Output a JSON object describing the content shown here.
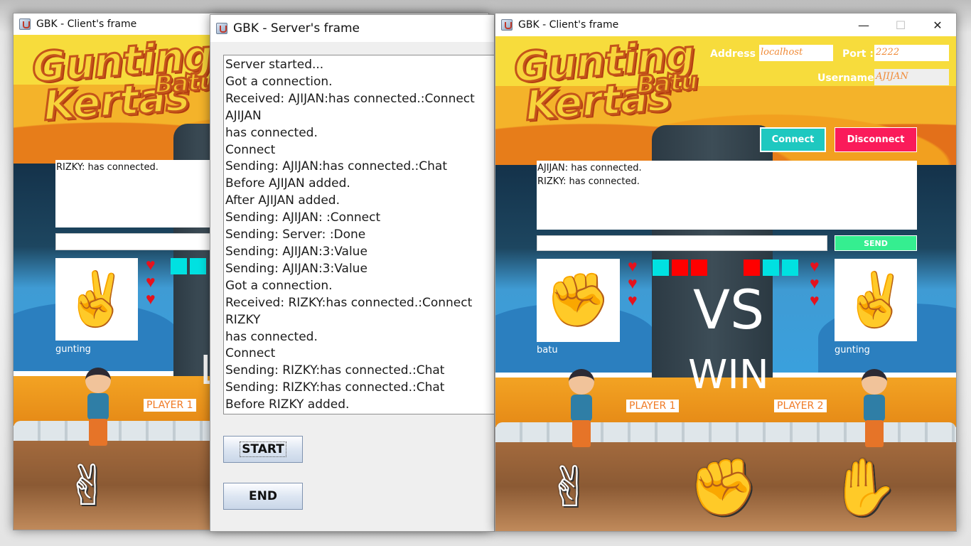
{
  "left_client": {
    "title": "GBK - Client's frame",
    "logo": {
      "line1": "Gunting",
      "batu": "Batu",
      "line2": "Kertas"
    },
    "chat_log": "RIZKY: has connected.",
    "hand_label": "gunting",
    "player_tag": "PLAYER 1",
    "partial_text": "L",
    "lives": 3,
    "squares": [
      "#00e1e1",
      "#00e1e1"
    ]
  },
  "server": {
    "title": "GBK - Server's frame",
    "log_lines": [
      "Server started...",
      "Got a connection.",
      "Received: AJIJAN:has connected.:Connect",
      "AJIJAN",
      "has connected.",
      "Connect",
      "Sending: AJIJAN:has connected.:Chat",
      "Before AJIJAN added.",
      "After AJIJAN added.",
      "Sending: AJIJAN: :Connect",
      "Sending: Server: :Done",
      "Sending: AJIJAN:3:Value",
      "Sending: AJIJAN:3:Value",
      "Got a connection.",
      "Received: RIZKY:has connected.:Connect",
      "RIZKY",
      "has connected.",
      "Connect",
      "Sending: RIZKY:has connected.:Chat",
      "Sending: RIZKY:has connected.:Chat",
      "Before RIZKY added."
    ],
    "start_label": "START",
    "end_label": "END"
  },
  "right_client": {
    "title": "GBK - Client's frame",
    "window_controls": {
      "minimize": "—",
      "maximize": "☐",
      "close": "✕"
    },
    "logo": {
      "line1": "Gunting",
      "batu": "Batu",
      "line2": "Kertas"
    },
    "address_label": "Address :",
    "address_value": "localhost",
    "port_label": "Port :",
    "port_value": "2222",
    "username_label": "Username :",
    "username_value": "AJIJAN",
    "connect_label": "Connect",
    "disconnect_label": "Disconnect",
    "chat_log": "AJIJAN: has connected.\nRIZKY: has connected.",
    "send_label": "SEND",
    "p1_hand_label": "batu",
    "p2_hand_label": "gunting",
    "vs_text": "VS",
    "result_text": "WIN",
    "player1_tag": "PLAYER 1",
    "player2_tag": "PLAYER 2",
    "p1_lives": 3,
    "p2_lives": 3,
    "p1_squares": [
      "#00e1e1",
      "#ff0000",
      "#ff0000"
    ],
    "p2_squares": [
      "#ff0000",
      "#00e1e1",
      "#00e1e1"
    ],
    "colors": {
      "connect": "#1ec8c0",
      "disconnect": "#fa1b5a",
      "send": "#35ee90"
    }
  }
}
